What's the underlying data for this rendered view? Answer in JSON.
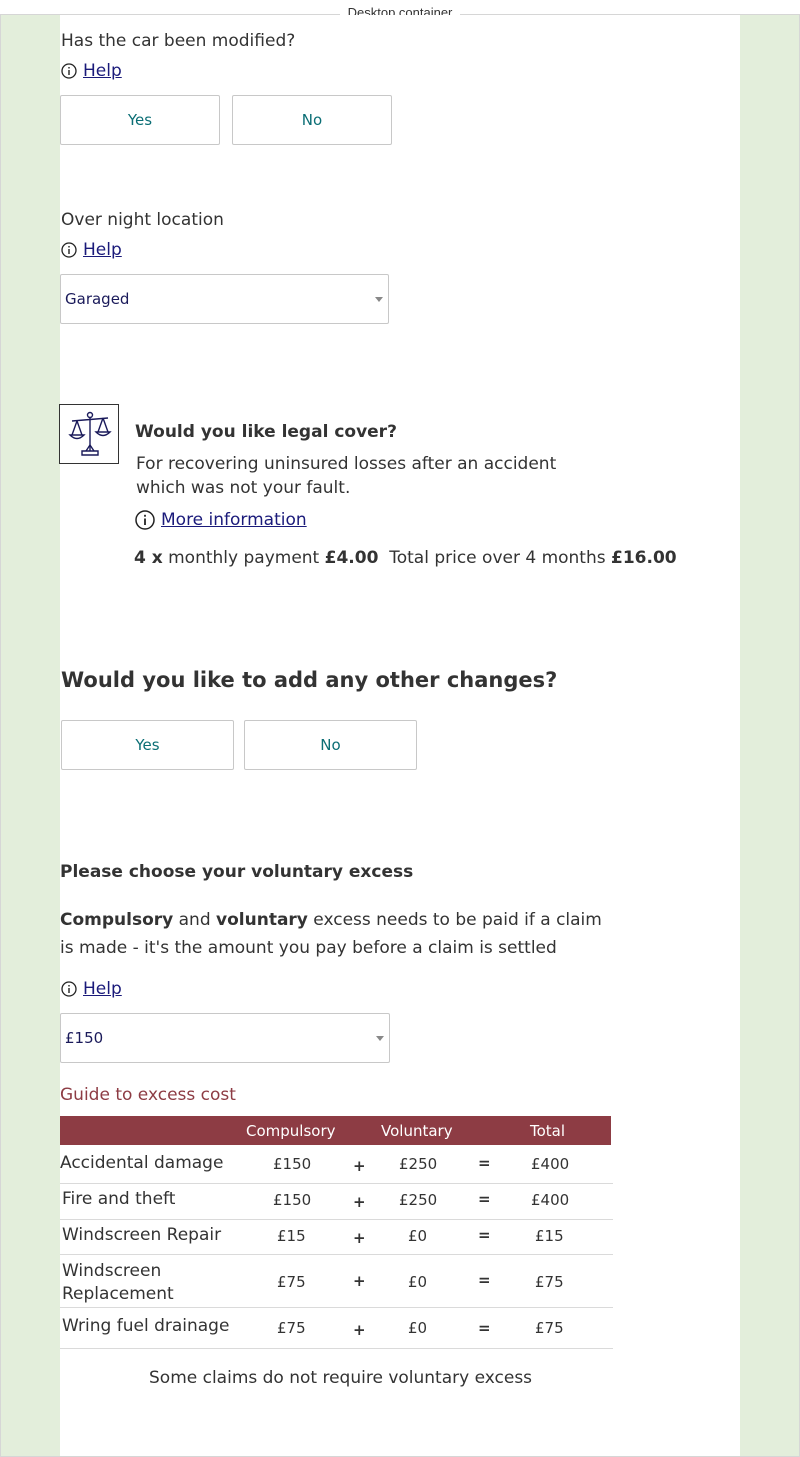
{
  "frame_label": "Desktop container",
  "modified": {
    "question": "Has the car been modified?",
    "help": "Help",
    "yes": "Yes",
    "no": "No"
  },
  "overnight": {
    "question": "Over night location",
    "help": "Help",
    "selected": "Garaged"
  },
  "legal": {
    "title": "Would you like legal cover?",
    "description": "For recovering uninsured losses after an accident which was not your fault.",
    "more_info": "More information",
    "count": "4 x",
    "monthly_label": "monthly payment",
    "monthly_value": "£4.00",
    "total_label": "Total price over 4 months",
    "total_value": "£16.00"
  },
  "other_changes": {
    "question": "Would you like to add any other changes?",
    "yes": "Yes",
    "no": "No"
  },
  "excess": {
    "heading": "Please choose your voluntary excess",
    "desc_bold1": "Compulsory",
    "desc_and": "and",
    "desc_bold2": "voluntary",
    "desc_rest": "excess needs to be paid if a claim is made - it's the amount you pay before a claim is settled",
    "help": "Help",
    "selected": "£150",
    "guide_title": "Guide to excess cost",
    "columns": [
      "Compulsory",
      "Voluntary",
      "Total"
    ],
    "plus": "+",
    "equals": "=",
    "rows": [
      {
        "label": "Accidental damage",
        "compulsory": "£150",
        "voluntary": "£250",
        "total": "£400"
      },
      {
        "label": "Fire and theft",
        "compulsory": "£150",
        "voluntary": "£250",
        "total": "£400"
      },
      {
        "label": "Windscreen Repair",
        "compulsory": "£15",
        "voluntary": "£0",
        "total": "£15"
      },
      {
        "label": "Windscreen Replacement",
        "compulsory": "£75",
        "voluntary": "£0",
        "total": "£75"
      },
      {
        "label": "Wring fuel drainage",
        "compulsory": "£75",
        "voluntary": "£0",
        "total": "£75"
      }
    ],
    "footnote": "Some claims do not require voluntary excess"
  },
  "colors": {
    "rail": "#e3eedb",
    "table_header": "#8d3c44",
    "guide_title": "#8d3c44",
    "button_text": "#0b6e75",
    "link": "#1a1a7a"
  },
  "icons": [
    "info-icon",
    "scales-icon",
    "dropdown-caret-icon"
  ]
}
